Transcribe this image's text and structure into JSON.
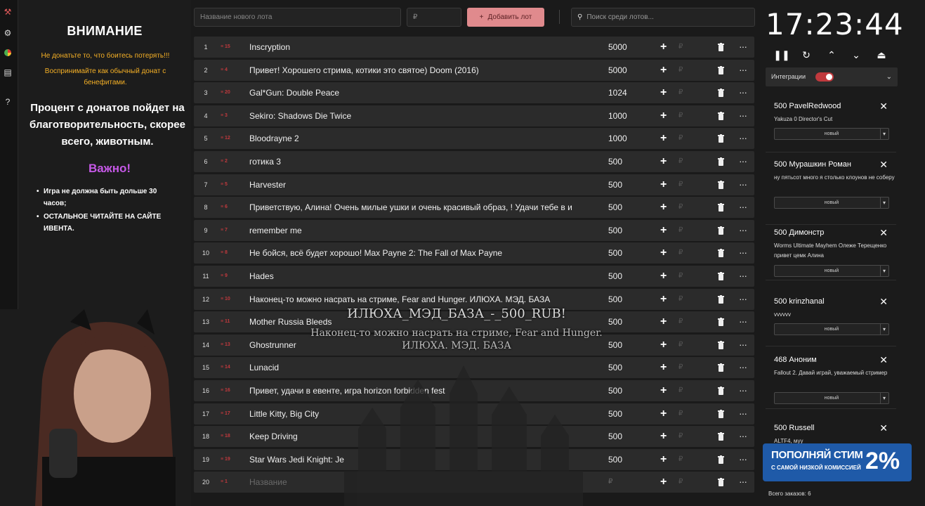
{
  "info": {
    "title": "ВНИМАНИЕ",
    "warning_line1": "Не донатьте то, что боитесь потерять!!!",
    "warning_line2": "Воспринимайте как обычный донат с бенефитами.",
    "charity": "Процент с донатов пойдет на благотворительность, скорее всего, животным.",
    "important": "Важно!",
    "rules": [
      "Игра не должна быть дольше 30 часов;",
      "ОСТАЛЬНОЕ ЧИТАЙТЕ НА САЙТЕ ИВЕНТА."
    ]
  },
  "toolbar": {
    "new_lot_placeholder": "Название нового лота",
    "amount_placeholder": "₽",
    "add_label": "Добавить лот",
    "search_placeholder": "Поиск среди лотов..."
  },
  "lots": [
    {
      "n": "1",
      "tag": "≡ 15",
      "name": "Inscryption",
      "sum": "5000"
    },
    {
      "n": "2",
      "tag": "≡ 4",
      "name": "Привет! Хорошего стрима, котики это святое) Doom (2016)",
      "sum": "5000"
    },
    {
      "n": "3",
      "tag": "≡ 20",
      "name": "Gal*Gun: Double Peace",
      "sum": "1024"
    },
    {
      "n": "4",
      "tag": "≡ 3",
      "name": "Sekiro: Shadows Die Twice",
      "sum": "1000"
    },
    {
      "n": "5",
      "tag": "≡ 12",
      "name": "Bloodrayne 2",
      "sum": "1000"
    },
    {
      "n": "6",
      "tag": "≡ 2",
      "name": "готика 3",
      "sum": "500"
    },
    {
      "n": "7",
      "tag": "≡ 5",
      "name": "Harvester",
      "sum": "500"
    },
    {
      "n": "8",
      "tag": "≡ 6",
      "name": "Приветствую, Алина! Очень милые ушки и очень красивый образ, ! Удачи тебе в и",
      "sum": "500"
    },
    {
      "n": "9",
      "tag": "≡ 7",
      "name": "remember me",
      "sum": "500"
    },
    {
      "n": "10",
      "tag": "≡ 8",
      "name": "Не бойся, всё будет хорошо! Max Payne 2: The Fall of Max Payne",
      "sum": "500"
    },
    {
      "n": "11",
      "tag": "≡ 9",
      "name": "Hades",
      "sum": "500"
    },
    {
      "n": "12",
      "tag": "≡ 10",
      "name": "Наконец-то можно насрать на стриме, Fear and Hunger. ИЛЮХА. МЭД. БАЗА",
      "sum": "500"
    },
    {
      "n": "13",
      "tag": "≡ 11",
      "name": "Mother Russia Bleeds",
      "sum": "500"
    },
    {
      "n": "14",
      "tag": "≡ 13",
      "name": "Ghostrunner",
      "sum": "500"
    },
    {
      "n": "15",
      "tag": "≡ 14",
      "name": "Lunacid",
      "sum": "500"
    },
    {
      "n": "16",
      "tag": "≡ 16",
      "name": "Привет, удачи в евенте, игра horizon forbidden fest",
      "sum": "500"
    },
    {
      "n": "17",
      "tag": "≡ 17",
      "name": "Little Kitty, Big City",
      "sum": "500"
    },
    {
      "n": "18",
      "tag": "≡ 18",
      "name": "Keep Driving",
      "sum": "500"
    },
    {
      "n": "19",
      "tag": "≡ 19",
      "name": "Star Wars Jedi Knight: Je",
      "sum": "500"
    },
    {
      "n": "20",
      "tag": "≡ 1",
      "name": "Название",
      "sum": "₽",
      "empty": true
    }
  ],
  "overlay": {
    "title": "ИЛЮХА_МЭД_БАЗА_-_500_RUB!",
    "message": "Наконец-то можно насрать на стриме, Fear and Hunger. ИЛЮХА. МЭД. БАЗА"
  },
  "timer": {
    "time": "17:23:44"
  },
  "integrations": {
    "label": "Интеграции",
    "enabled": true
  },
  "donations": [
    {
      "head": "500 PavelRedwood",
      "msg": "Yakuza 0 Director's Cut",
      "status": "новый"
    },
    {
      "head": "500 Мурашкин Роман",
      "msg": "ну пятьсот много я столько клоунов не соберу",
      "status": "новый"
    },
    {
      "head": "500 Димонстр",
      "msg": "Worms Ultimate Mayhem Олеже Терещенко привет цемк Алина",
      "status": "новый"
    },
    {
      "head": "500 krinzhanal",
      "msg": "vvvvvv",
      "status": "новый"
    },
    {
      "head": "468 Аноним",
      "msg": "Fallout 2. Давай играй, уважаемый стример",
      "status": "новый"
    },
    {
      "head": "500 Russell",
      "msg": "ALTF4, муу",
      "status": ""
    }
  ],
  "promo": {
    "line1": "ПОПОЛНЯЙ СТИМ",
    "line2": "С САМОЙ НИЗКОЙ КОМИССИЕЙ",
    "value": "2%"
  },
  "footer": {
    "total": "Всего заказов: 6"
  },
  "colors": {
    "accent": "#c0393d",
    "add_button": "#e08a8d",
    "warning": "#f5b026",
    "important": "#c558e6"
  }
}
